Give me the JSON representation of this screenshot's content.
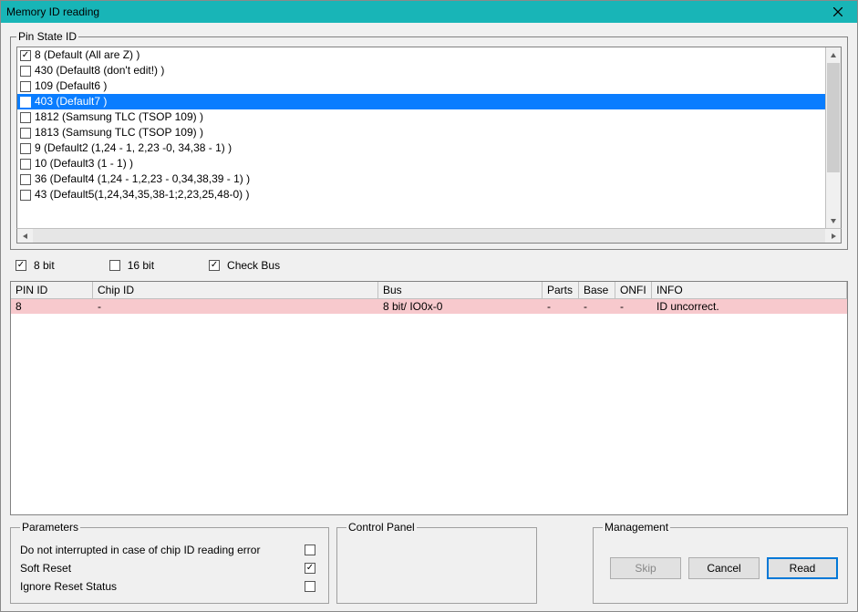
{
  "window": {
    "title": "Memory ID reading"
  },
  "pinstate": {
    "legend": "Pin State ID",
    "items": [
      {
        "label": "8 (Default (All are Z) )",
        "checked": true,
        "selected": false
      },
      {
        "label": "430 (Default8 (don't edit!) )",
        "checked": false,
        "selected": false
      },
      {
        "label": "109 (Default6 )",
        "checked": false,
        "selected": false
      },
      {
        "label": "403 (Default7 )",
        "checked": false,
        "selected": true
      },
      {
        "label": "1812 (Samsung TLC (TSOP 109) )",
        "checked": false,
        "selected": false
      },
      {
        "label": "1813 (Samsung TLC (TSOP 109) )",
        "checked": false,
        "selected": false
      },
      {
        "label": "9 (Default2 (1,24 - 1, 2,23 -0, 34,38 - 1) )",
        "checked": false,
        "selected": false
      },
      {
        "label": "10 (Default3 (1 - 1) )",
        "checked": false,
        "selected": false
      },
      {
        "label": "36 (Default4 (1,24 - 1,2,23 - 0,34,38,39 - 1) )",
        "checked": false,
        "selected": false
      },
      {
        "label": "43 (Default5(1,24,34,35,38-1;2,23,25,48-0) )",
        "checked": false,
        "selected": false
      }
    ]
  },
  "options": {
    "eight_bit": {
      "label": "8 bit",
      "checked": true
    },
    "sixteen_bit": {
      "label": "16 bit",
      "checked": false
    },
    "check_bus": {
      "label": "Check Bus",
      "checked": true
    }
  },
  "table": {
    "columns": {
      "pin": "PIN ID",
      "chip": "Chip ID",
      "bus": "Bus",
      "parts": "Parts",
      "base": "Base",
      "onfi": "ONFI",
      "info": "INFO"
    },
    "rows": [
      {
        "pin": "8",
        "chip": "-",
        "bus": "8 bit/ IO0x-0",
        "parts": "-",
        "base": "-",
        "onfi": "-",
        "info": "ID uncorrect.",
        "error": true
      }
    ]
  },
  "parameters": {
    "legend": "Parameters",
    "dont_interrupt": {
      "label": "Do not interrupted in case of chip ID reading error",
      "checked": false
    },
    "soft_reset": {
      "label": "Soft Reset",
      "checked": true
    },
    "ignore_reset": {
      "label": "Ignore Reset Status",
      "checked": false
    }
  },
  "control_panel": {
    "legend": "Control Panel"
  },
  "management": {
    "legend": "Management",
    "skip": "Skip",
    "cancel": "Cancel",
    "read": "Read"
  }
}
